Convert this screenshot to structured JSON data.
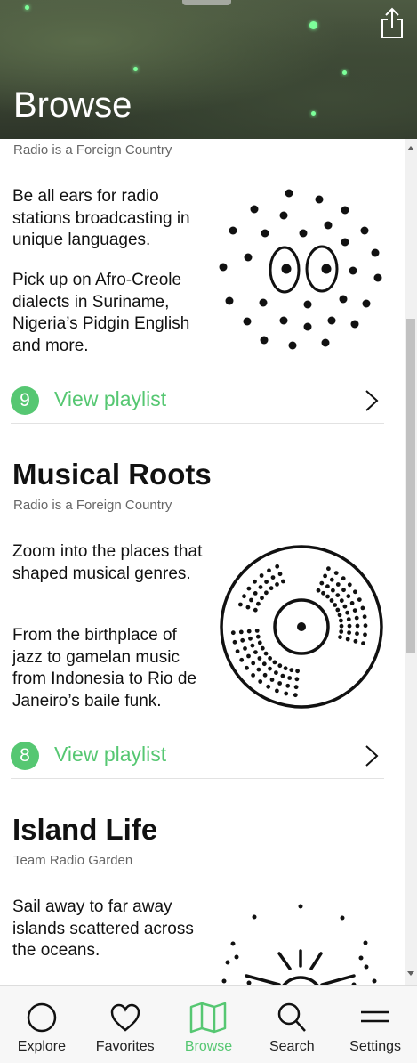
{
  "header": {
    "title": "Browse"
  },
  "sections": [
    {
      "title": "",
      "subtitle": "Radio is a Foreign Country",
      "paragraphs": [
        "Be all ears for radio stations broadcasting in unique languages.",
        "Pick up on Afro-Creole dialects in Suriname, Nigeria’s Pidgin English and more."
      ],
      "playlist": {
        "count": "9",
        "label": "View playlist"
      },
      "icon": "face-dots-icon"
    },
    {
      "title": "Musical Roots",
      "subtitle": "Radio is a Foreign Country",
      "paragraphs": [
        "Zoom into the places that shaped musical genres.",
        "From the birthplace of jazz to gamelan music from Indonesia to Rio de Janeiro’s baile funk."
      ],
      "playlist": {
        "count": "8",
        "label": "View playlist"
      },
      "icon": "vinyl-record-icon"
    },
    {
      "title": "Island Life",
      "subtitle": "Team Radio Garden",
      "paragraphs": [
        "Sail away to far away islands scattered across the oceans."
      ],
      "icon": "sun-icon"
    }
  ],
  "nav": [
    {
      "label": "Explore",
      "icon": "globe-icon"
    },
    {
      "label": "Favorites",
      "icon": "heart-icon"
    },
    {
      "label": "Browse",
      "icon": "map-icon",
      "active": true
    },
    {
      "label": "Search",
      "icon": "search-icon"
    },
    {
      "label": "Settings",
      "icon": "menu-icon"
    }
  ],
  "colors": {
    "accent": "#56c772"
  }
}
